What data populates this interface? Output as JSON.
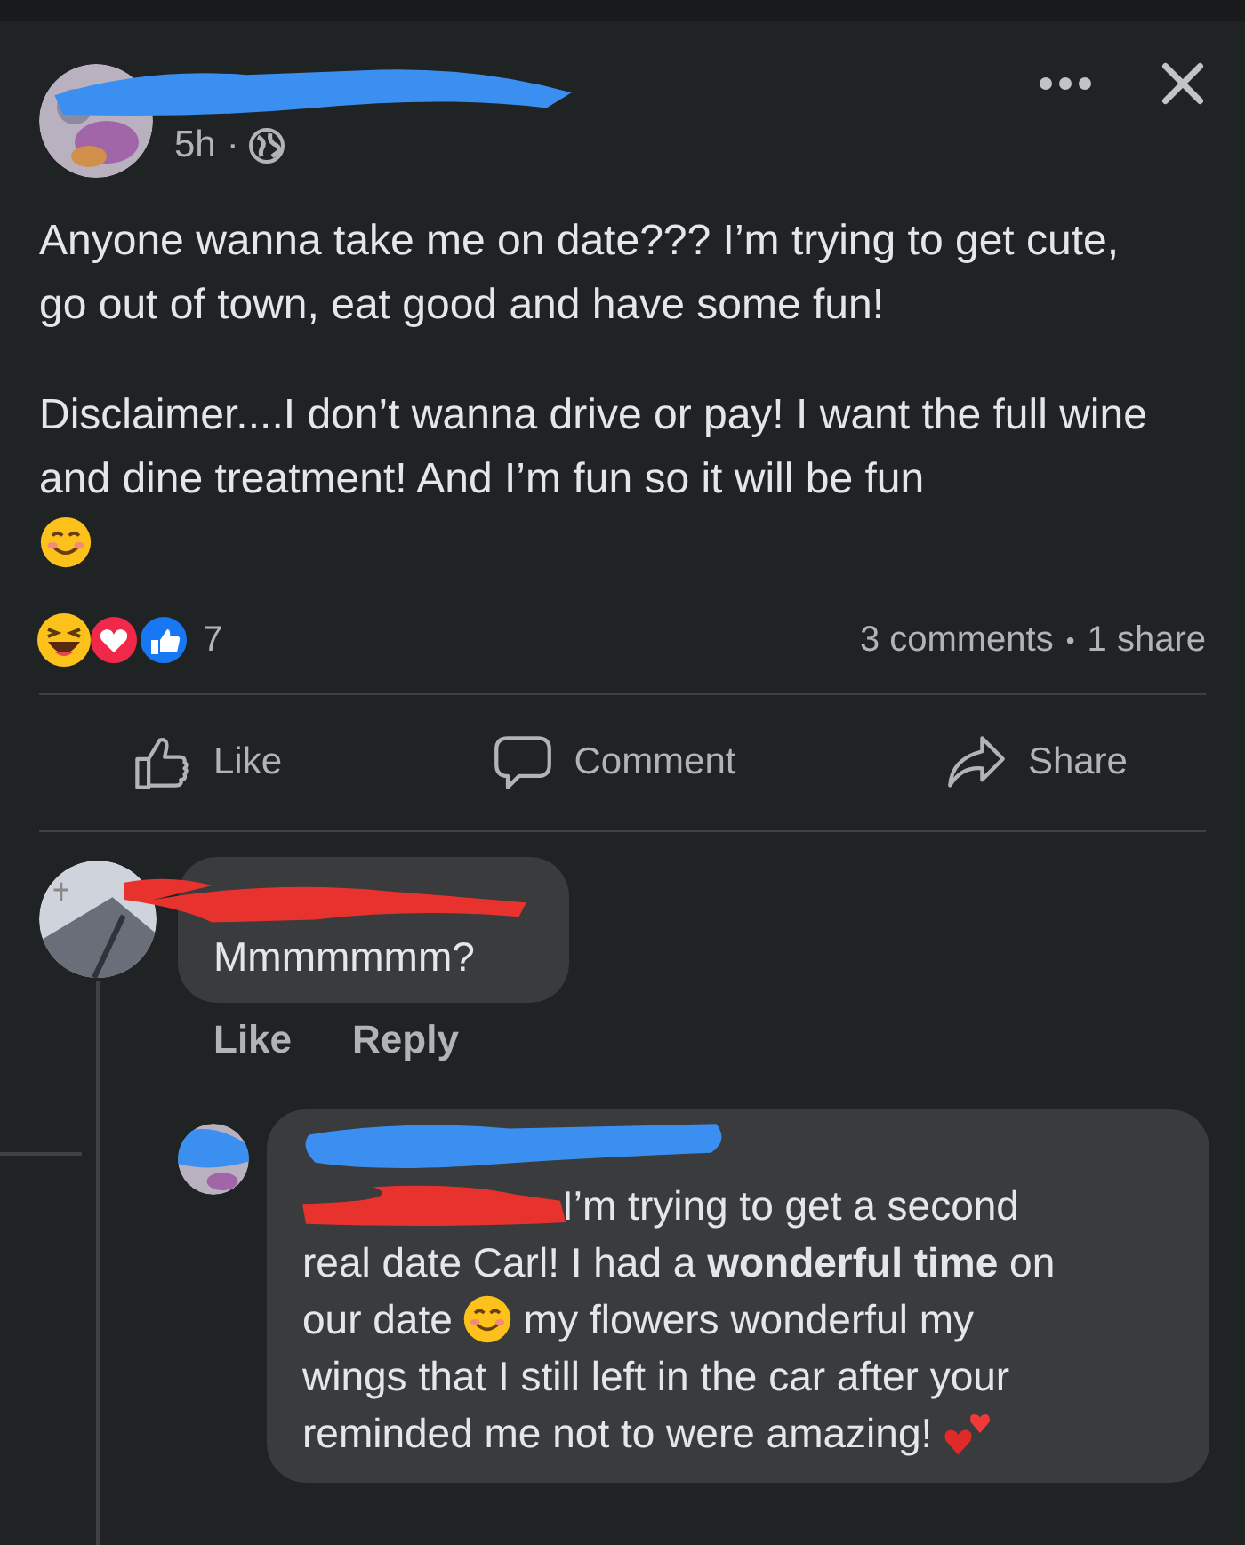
{
  "post": {
    "time": "5h",
    "time_separator": "·",
    "paragraphs": [
      "Anyone wanna take me on date??? I’m trying to get cute, go out of town, eat good and have some fun!",
      "Disclaimer....I don’t wanna drive or pay! I want the full wine and dine treatment! And I’m fun so it will be fun"
    ],
    "reactions": {
      "count": "7"
    },
    "comments_count": "3 comments",
    "separator": "•",
    "shares": "1 share",
    "actions": [
      {
        "kind": "like",
        "label": "Like"
      },
      {
        "kind": "comment",
        "label": "Comment"
      },
      {
        "kind": "share",
        "label": "Share"
      }
    ]
  },
  "comments": [
    {
      "segments": [
        {
          "kind": "text",
          "text": "Mmmmmmm?"
        }
      ],
      "actions": [
        "Like",
        "Reply"
      ],
      "replies": [
        {
          "lines": [
            [
              {
                "kind": "mention"
              },
              {
                "kind": "text",
                "text": "I’m trying to get a second"
              }
            ],
            [
              {
                "kind": "text",
                "text": "real date Carl! I had a **wonderful time** on"
              }
            ],
            [
              {
                "kind": "text",
                "text": "our date"
              },
              {
                "kind": "smile"
              },
              {
                "kind": "text",
                "text": "my flowers wonderful my"
              }
            ],
            [
              {
                "kind": "text",
                "text": "wings that I still left in the car after your"
              }
            ],
            [
              {
                "kind": "text",
                "text": "reminded me not to were amazing!"
              },
              {
                "kind": "hearts"
              }
            ]
          ]
        }
      ]
    }
  ]
}
